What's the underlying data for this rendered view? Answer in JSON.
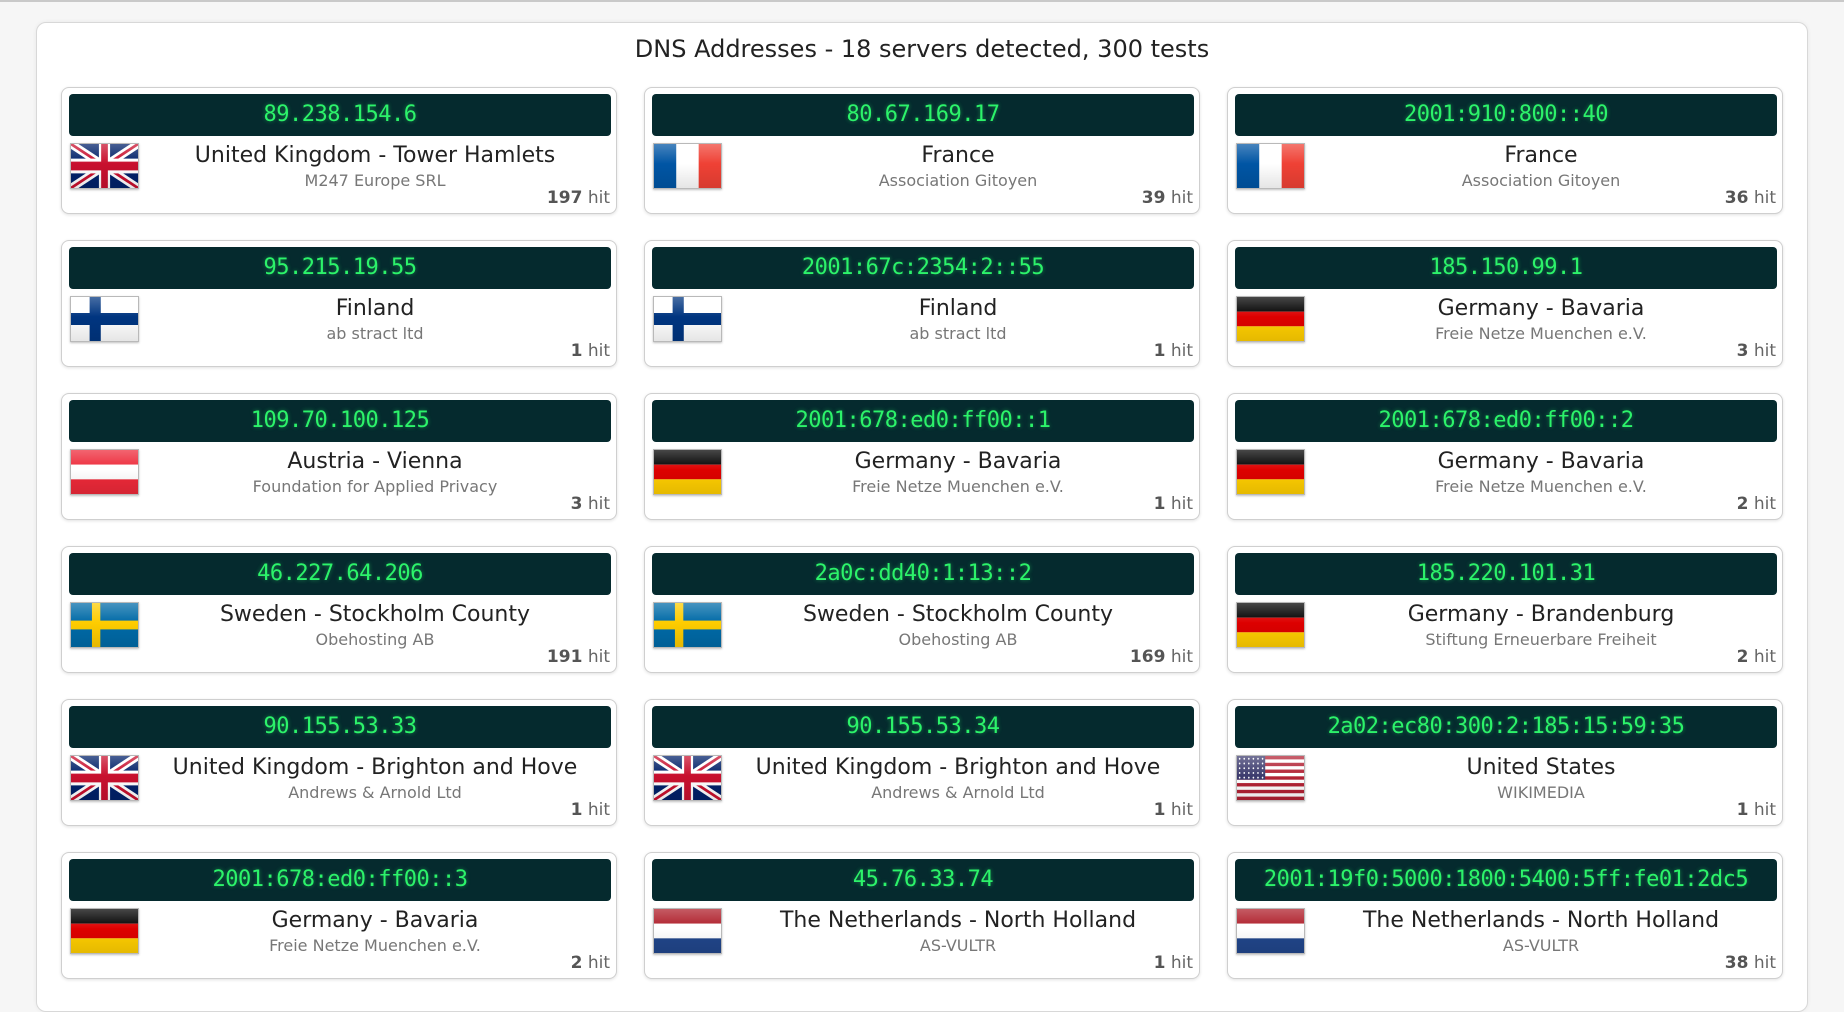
{
  "title": "DNS Addresses - 18 servers detected, 300 tests",
  "hit_label": "hit",
  "servers": [
    {
      "ip": "89.238.154.6",
      "location": "United Kingdom - Tower Hamlets",
      "org": "M247 Europe SRL",
      "hits": "197",
      "flag": "gb"
    },
    {
      "ip": "80.67.169.17",
      "location": "France",
      "org": "Association Gitoyen",
      "hits": "39",
      "flag": "fr"
    },
    {
      "ip": "2001:910:800::40",
      "location": "France",
      "org": "Association Gitoyen",
      "hits": "36",
      "flag": "fr"
    },
    {
      "ip": "95.215.19.55",
      "location": "Finland",
      "org": "ab stract ltd",
      "hits": "1",
      "flag": "fi"
    },
    {
      "ip": "2001:67c:2354:2::55",
      "location": "Finland",
      "org": "ab stract ltd",
      "hits": "1",
      "flag": "fi"
    },
    {
      "ip": "185.150.99.1",
      "location": "Germany - Bavaria",
      "org": "Freie Netze Muenchen e.V.",
      "hits": "3",
      "flag": "de"
    },
    {
      "ip": "109.70.100.125",
      "location": "Austria - Vienna",
      "org": "Foundation for Applied Privacy",
      "hits": "3",
      "flag": "at"
    },
    {
      "ip": "2001:678:ed0:ff00::1",
      "location": "Germany - Bavaria",
      "org": "Freie Netze Muenchen e.V.",
      "hits": "1",
      "flag": "de"
    },
    {
      "ip": "2001:678:ed0:ff00::2",
      "location": "Germany - Bavaria",
      "org": "Freie Netze Muenchen e.V.",
      "hits": "2",
      "flag": "de"
    },
    {
      "ip": "46.227.64.206",
      "location": "Sweden - Stockholm County",
      "org": "Obehosting AB",
      "hits": "191",
      "flag": "se"
    },
    {
      "ip": "2a0c:dd40:1:13::2",
      "location": "Sweden - Stockholm County",
      "org": "Obehosting AB",
      "hits": "169",
      "flag": "se"
    },
    {
      "ip": "185.220.101.31",
      "location": "Germany - Brandenburg",
      "org": "Stiftung Erneuerbare Freiheit",
      "hits": "2",
      "flag": "de"
    },
    {
      "ip": "90.155.53.33",
      "location": "United Kingdom - Brighton and Hove",
      "org": "Andrews & Arnold Ltd",
      "hits": "1",
      "flag": "gb"
    },
    {
      "ip": "90.155.53.34",
      "location": "United Kingdom - Brighton and Hove",
      "org": "Andrews & Arnold Ltd",
      "hits": "1",
      "flag": "gb"
    },
    {
      "ip": "2a02:ec80:300:2:185:15:59:35",
      "location": "United States",
      "org": "WIKIMEDIA",
      "hits": "1",
      "flag": "us"
    },
    {
      "ip": "2001:678:ed0:ff00::3",
      "location": "Germany - Bavaria",
      "org": "Freie Netze Muenchen e.V.",
      "hits": "2",
      "flag": "de"
    },
    {
      "ip": "45.76.33.74",
      "location": "The Netherlands - North Holland",
      "org": "AS-VULTR",
      "hits": "1",
      "flag": "nl"
    },
    {
      "ip": "2001:19f0:5000:1800:5400:5ff:fe01:2dc5",
      "location": "The Netherlands - North Holland",
      "org": "AS-VULTR",
      "hits": "38",
      "flag": "nl"
    }
  ]
}
